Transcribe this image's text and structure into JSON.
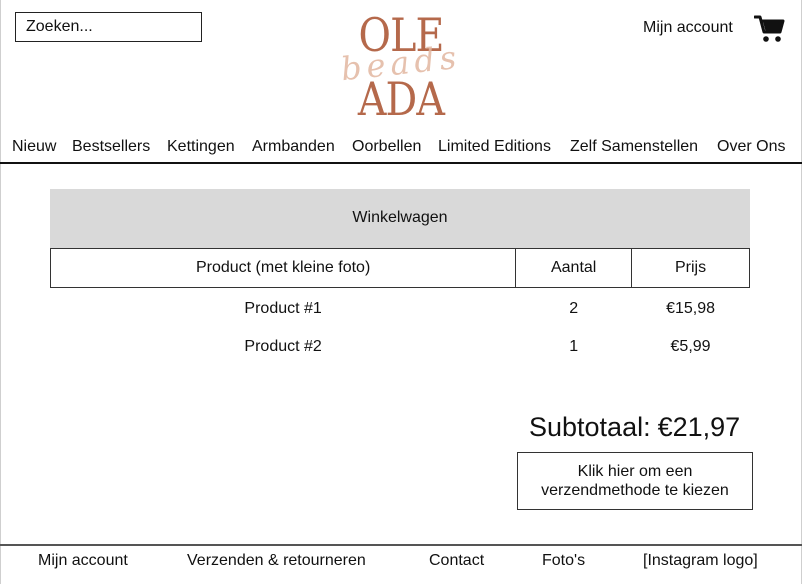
{
  "header": {
    "search_placeholder": "Zoeken...",
    "account_label": "Mijn account",
    "cart_icon": "shopping-cart-icon",
    "logo": {
      "line1": "OLE",
      "line2": "beads",
      "line3": "ADA"
    }
  },
  "nav": {
    "items": [
      "Nieuw",
      "Bestsellers",
      "Kettingen",
      "Armbanden",
      "Oorbellen",
      "Limited Editions",
      "Zelf Samenstellen",
      "Over Ons"
    ]
  },
  "cart": {
    "title": "Winkelwagen",
    "columns": [
      "Product (met kleine foto)",
      "Aantal",
      "Prijs"
    ],
    "rows": [
      {
        "product": "Product #1",
        "qty": "2",
        "price": "€15,98"
      },
      {
        "product": "Product #2",
        "qty": "1",
        "price": "€5,99"
      }
    ],
    "subtotal_label": "Subtotaal:",
    "subtotal_value": "€21,97",
    "shipping_button": {
      "line1": "Klik hier om een",
      "line2": "verzendmethode te kiezen"
    }
  },
  "footer": {
    "items": [
      "Mijn account",
      "Verzenden & retourneren",
      "Contact",
      "Foto's",
      "[Instagram logo]"
    ]
  },
  "colors": {
    "logo_accent": "#b5694b",
    "logo_script": "#e2b7a0",
    "panel_gray": "#d9d9d9"
  }
}
